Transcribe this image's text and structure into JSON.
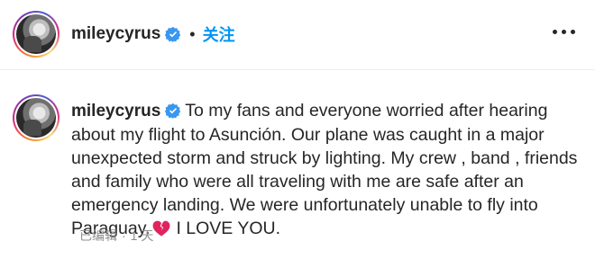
{
  "header": {
    "username": "mileycyrus",
    "separator": "•",
    "follow_label": "关注"
  },
  "post": {
    "username": "mileycyrus",
    "caption": "To my fans and everyone worried after hearing about my flight to Asunción. Our plane was caught in a major unexpected storm and struck by lighting. My crew , band , friends and family who were all traveling with me are safe after an emergency landing. We were unfortunately unable to fly into Paraguay.",
    "caption_end": "I LOVE YOU.",
    "edited_label": "已编辑",
    "meta_separator": "·",
    "time_ago": "1 天"
  },
  "icons": {
    "verified": "verified-badge-icon",
    "more": "more-horizontal-icon",
    "heart": "broken-heart-icon"
  },
  "colors": {
    "accent": "#0095f6",
    "text": "#262626",
    "secondary": "#8e8e8e",
    "heart": "#e0245e"
  }
}
